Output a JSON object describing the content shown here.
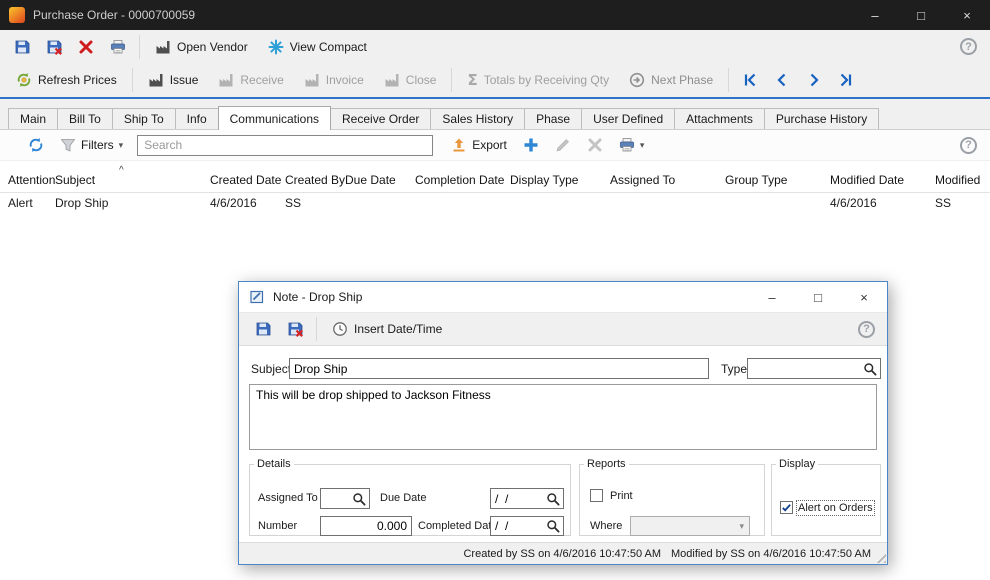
{
  "window_glyphs": {
    "minimize": "–",
    "maximize": "□",
    "close": "×"
  },
  "icons": {
    "help_glyph": "?",
    "caret_down": "▾",
    "sigma_glyph": "Σ"
  },
  "titlebar": {
    "title": "Purchase Order - 0000700059"
  },
  "toolbar_top": {
    "open_vendor_label": "Open Vendor",
    "view_compact_label": "View Compact"
  },
  "toolbar_actions": {
    "refresh_prices_label": "Refresh Prices",
    "issue_label": "Issue",
    "receive_label": "Receive",
    "invoice_label": "Invoice",
    "close_label": "Close",
    "totals_label": "Totals by Receiving Qty",
    "next_phase_label": "Next Phase"
  },
  "tabs": [
    {
      "label": "Main"
    },
    {
      "label": "Bill To"
    },
    {
      "label": "Ship To"
    },
    {
      "label": "Info"
    },
    {
      "label": "Communications"
    },
    {
      "label": "Receive Order"
    },
    {
      "label": "Sales History"
    },
    {
      "label": "Phase"
    },
    {
      "label": "User Defined"
    },
    {
      "label": "Attachments"
    },
    {
      "label": "Purchase History"
    }
  ],
  "comm_toolbar": {
    "filters_label": "Filters",
    "search_placeholder": "Search",
    "export_label": "Export"
  },
  "grid": {
    "sort_indicator": "^",
    "columns": [
      "Attention",
      "Subject",
      "Created Date",
      "Created By",
      "Due Date",
      "Completion Date",
      "Display Type",
      "Assigned To",
      "Group Type",
      "Modified Date",
      "Modified"
    ],
    "row": {
      "attention": "Alert",
      "subject": "Drop Ship",
      "created_date": "4/6/2016",
      "created_by": "SS",
      "due_date": "",
      "completion_date": "",
      "display_type": "",
      "assigned_to": "",
      "group_type": "",
      "modified_date": "4/6/2016",
      "modified_by": "SS"
    }
  },
  "dialog": {
    "title": "Note - Drop Ship",
    "toolbar": {
      "insert_datetime_label": "Insert Date/Time"
    },
    "fields": {
      "subject_label": "Subject",
      "subject_value": "Drop Ship",
      "type_label": "Type",
      "type_value": ""
    },
    "note_body": "This will be drop shipped to Jackson Fitness",
    "details": {
      "legend": "Details",
      "assigned_to_label": "Assigned To",
      "assigned_to_value": "",
      "due_date_label": "Due Date",
      "due_date_value": "/  /",
      "number_label": "Number",
      "number_value": "0.000",
      "completed_date_label": "Completed Date",
      "completed_date_value": "/  /"
    },
    "reports": {
      "legend": "Reports",
      "print_label": "Print",
      "where_label": "Where"
    },
    "display": {
      "legend": "Display",
      "alert_on_orders_label": "Alert on Orders"
    },
    "status_created": "Created by SS on 4/6/2016 10:47:50 AM",
    "status_modified": "Modified by SS on 4/6/2016 10:47:50 AM"
  },
  "colors": {
    "titlebar_bg": "#1e1e1e",
    "accent_blue": "#2e75c8",
    "nav_blue": "#1761c0",
    "danger_red": "#cf1d1d"
  }
}
